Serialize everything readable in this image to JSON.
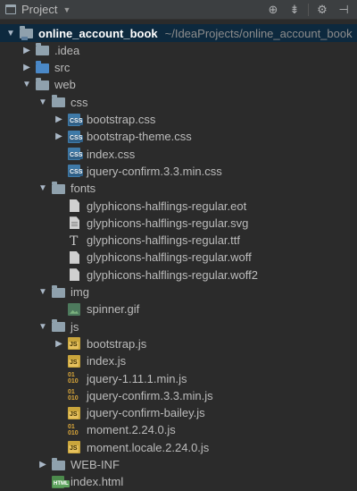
{
  "header": {
    "title": "Project",
    "icons": [
      "target-icon",
      "collapse-icon",
      "gear-icon",
      "hide-icon"
    ]
  },
  "tree": [
    {
      "label": "online_account_book",
      "path": "~/IdeaProjects/online_account_book",
      "level": 0,
      "arrow": "down",
      "icon": "folder-root",
      "bold": true
    },
    {
      "label": ".idea",
      "level": 1,
      "arrow": "right",
      "icon": "folder"
    },
    {
      "label": "src",
      "level": 1,
      "arrow": "right",
      "icon": "folder-blue"
    },
    {
      "label": "web",
      "level": 1,
      "arrow": "down",
      "icon": "folder"
    },
    {
      "label": "css",
      "level": 2,
      "arrow": "down",
      "icon": "folder"
    },
    {
      "label": "bootstrap.css",
      "level": 3,
      "arrow": "right",
      "icon": "css-file"
    },
    {
      "label": "bootstrap-theme.css",
      "level": 3,
      "arrow": "right",
      "icon": "css-file"
    },
    {
      "label": "index.css",
      "level": 3,
      "arrow": "none",
      "icon": "css-file"
    },
    {
      "label": "jquery-confirm.3.3.min.css",
      "level": 3,
      "arrow": "none",
      "icon": "css-file"
    },
    {
      "label": "fonts",
      "level": 2,
      "arrow": "down",
      "icon": "folder"
    },
    {
      "label": "glyphicons-halflings-regular.eot",
      "level": 3,
      "arrow": "none",
      "icon": "file"
    },
    {
      "label": "glyphicons-halflings-regular.svg",
      "level": 3,
      "arrow": "none",
      "icon": "text-file"
    },
    {
      "label": "glyphicons-halflings-regular.ttf",
      "level": 3,
      "arrow": "none",
      "icon": "font-file"
    },
    {
      "label": "glyphicons-halflings-regular.woff",
      "level": 3,
      "arrow": "none",
      "icon": "file"
    },
    {
      "label": "glyphicons-halflings-regular.woff2",
      "level": 3,
      "arrow": "none",
      "icon": "file"
    },
    {
      "label": "img",
      "level": 2,
      "arrow": "down",
      "icon": "folder"
    },
    {
      "label": "spinner.gif",
      "level": 3,
      "arrow": "none",
      "icon": "image-file"
    },
    {
      "label": "js",
      "level": 2,
      "arrow": "down",
      "icon": "folder"
    },
    {
      "label": "bootstrap.js",
      "level": 3,
      "arrow": "right",
      "icon": "js-file"
    },
    {
      "label": "index.js",
      "level": 3,
      "arrow": "none",
      "icon": "js-file"
    },
    {
      "label": "jquery-1.11.1.min.js",
      "level": 3,
      "arrow": "none",
      "icon": "min-js-file"
    },
    {
      "label": "jquery-confirm.3.3.min.js",
      "level": 3,
      "arrow": "none",
      "icon": "min-js-file"
    },
    {
      "label": "jquery-confirm-bailey.js",
      "level": 3,
      "arrow": "none",
      "icon": "js-file"
    },
    {
      "label": "moment.2.24.0.js",
      "level": 3,
      "arrow": "none",
      "icon": "min-js-file"
    },
    {
      "label": "moment.locale.2.24.0.js",
      "level": 3,
      "arrow": "none",
      "icon": "js-file"
    },
    {
      "label": "WEB-INF",
      "level": 2,
      "arrow": "right",
      "icon": "folder"
    },
    {
      "label": "index.html",
      "level": 2,
      "arrow": "none",
      "icon": "html-file"
    }
  ]
}
